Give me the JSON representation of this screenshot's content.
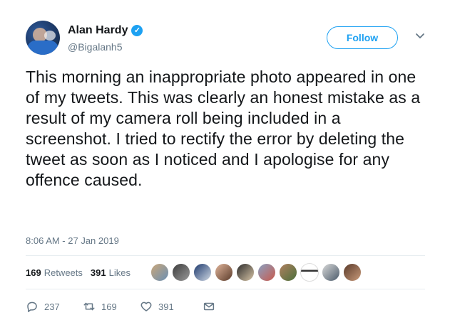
{
  "user": {
    "name": "Alan Hardy",
    "handle": "@Bigalanh5",
    "verified_icon": "verified-badge-icon"
  },
  "follow_button": {
    "label": "Follow"
  },
  "tweet": {
    "text": "This morning an inappropriate photo appeared in one of my tweets. This was clearly an honest mistake as a result of my camera roll being included in a screenshot. I tried to rectify the error by deleting the tweet as soon as I noticed and I apologise for any offence caused.",
    "timestamp": "8:06 AM - 27 Jan 2019"
  },
  "stats": {
    "retweets_count": "169",
    "retweets_label": "Retweets",
    "likes_count": "391",
    "likes_label": "Likes"
  },
  "actions": {
    "reply_count": "237",
    "retweet_count": "169",
    "like_count": "391"
  },
  "colors": {
    "accent": "#1da1f2",
    "text": "#14171a",
    "muted": "#657786",
    "divider": "#e6ecf0"
  }
}
